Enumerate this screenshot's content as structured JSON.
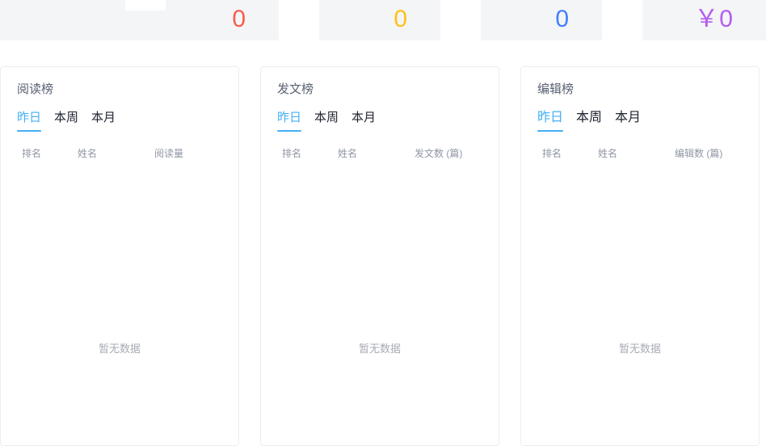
{
  "stats": {
    "cards": [
      {
        "id": "stat-1",
        "value": "0",
        "color": "#fa5c4b"
      },
      {
        "id": "stat-2",
        "value": "0",
        "color": "#ffc017"
      },
      {
        "id": "stat-3",
        "value": "0",
        "color": "#4080ff"
      },
      {
        "id": "stat-4",
        "value": "￥0",
        "color": "#b55cf0"
      }
    ]
  },
  "panels": [
    {
      "title": "阅读榜",
      "tabs": [
        {
          "label": "昨日",
          "active": true
        },
        {
          "label": "本周",
          "active": false
        },
        {
          "label": "本月",
          "active": false
        }
      ],
      "columns": {
        "rank": "排名",
        "name": "姓名",
        "value": "阅读量"
      },
      "empty_text": "暂无数据"
    },
    {
      "title": "发文榜",
      "tabs": [
        {
          "label": "昨日",
          "active": true
        },
        {
          "label": "本周",
          "active": false
        },
        {
          "label": "本月",
          "active": false
        }
      ],
      "columns": {
        "rank": "排名",
        "name": "姓名",
        "value": "发文数 (篇)"
      },
      "empty_text": "暂无数据"
    },
    {
      "title": "编辑榜",
      "tabs": [
        {
          "label": "昨日",
          "active": true
        },
        {
          "label": "本周",
          "active": false
        },
        {
          "label": "本月",
          "active": false
        }
      ],
      "columns": {
        "rank": "排名",
        "name": "姓名",
        "value": "编辑数 (篇)"
      },
      "empty_text": "暂无数据"
    }
  ]
}
